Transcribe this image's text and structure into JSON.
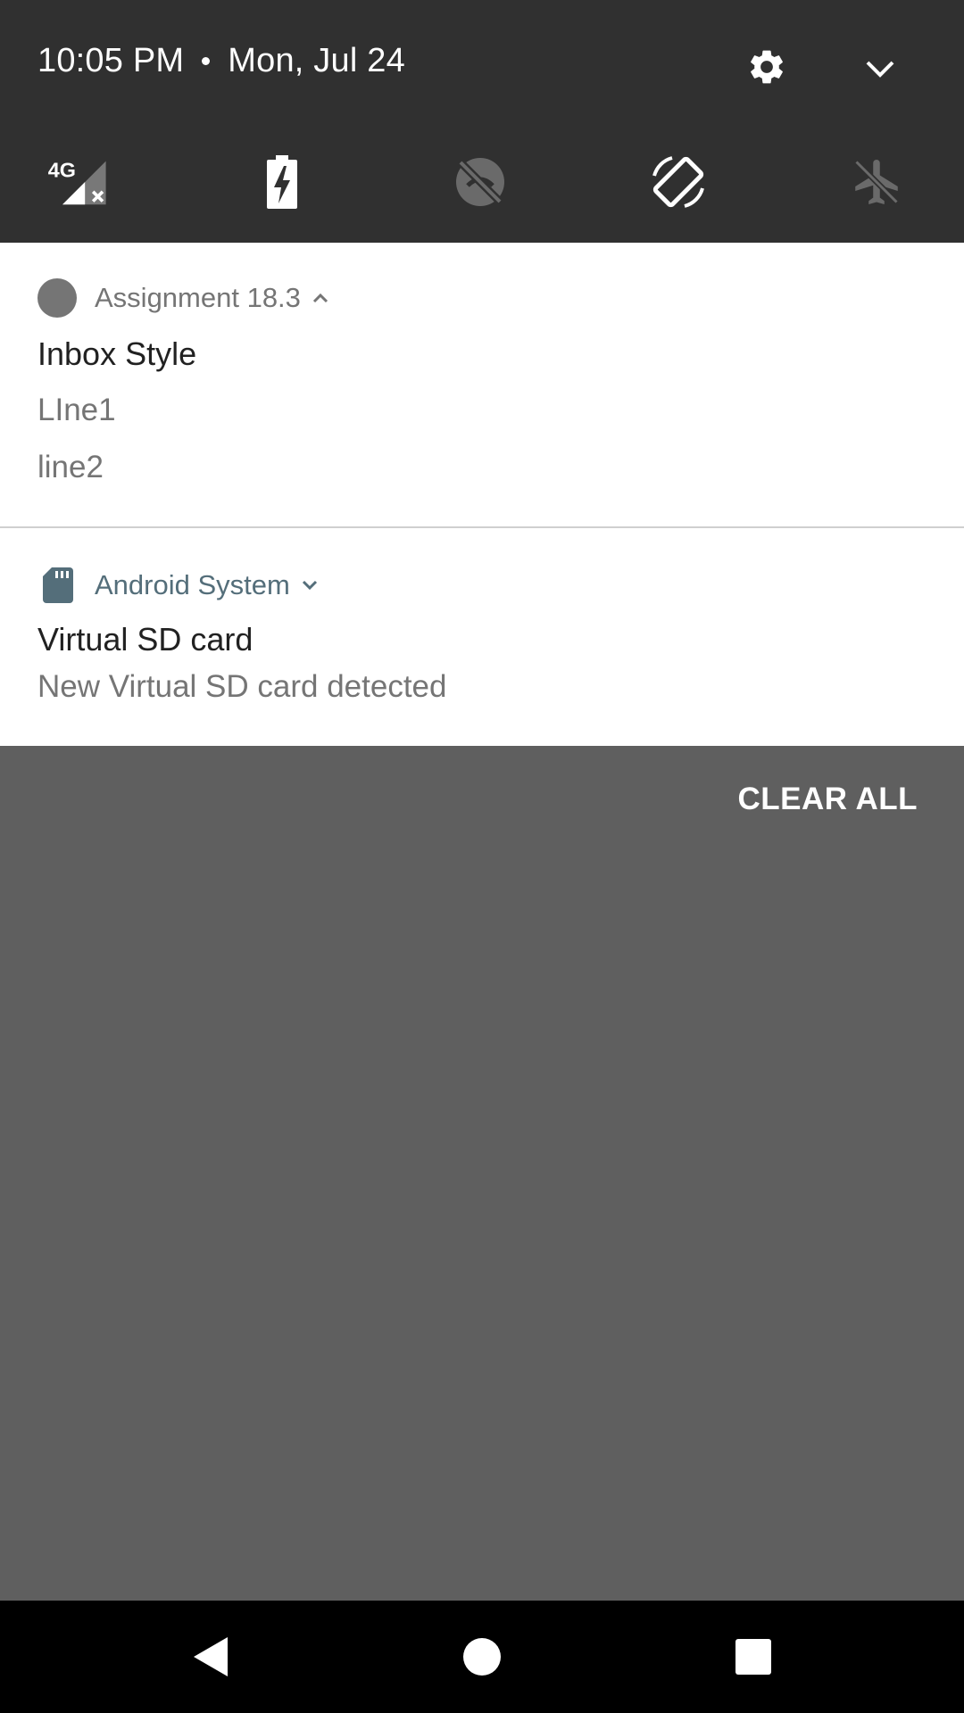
{
  "quick_settings": {
    "time": "10:05 PM",
    "date": "Mon, Jul 24",
    "network_label": "4G",
    "icons": {
      "settings": "gear-icon",
      "expand": "chevron-down-icon",
      "tiles": [
        "mobile-data-icon",
        "battery-saver-icon",
        "location-off-icon",
        "auto-rotate-icon",
        "airplane-mode-icon"
      ]
    }
  },
  "notifications": [
    {
      "app_name": "Assignment 18.3",
      "icon": "app-circle-icon",
      "expanded": true,
      "title": "Inbox Style",
      "lines": [
        "LIne1",
        "line2"
      ]
    },
    {
      "app_name": "Android System",
      "icon": "sd-card-icon",
      "expanded": false,
      "title": "Virtual SD card",
      "text": "New Virtual SD card detected"
    }
  ],
  "shade": {
    "clear_all_label": "CLEAR ALL"
  },
  "nav_bar": {
    "buttons": [
      "back-icon",
      "home-icon",
      "recents-icon"
    ]
  },
  "colors": {
    "header_bg": "#303030",
    "shade_bg": "#5f5f5f",
    "system_accent": "#546e7a"
  }
}
